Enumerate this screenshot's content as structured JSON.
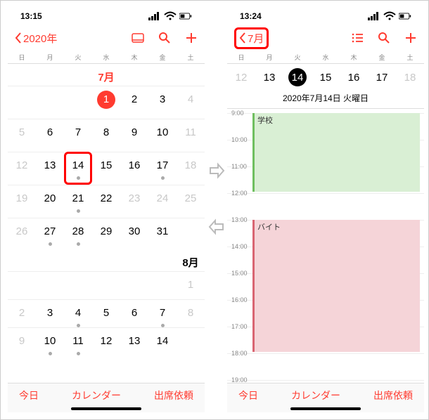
{
  "left": {
    "status_time": "13:15",
    "back_label": "2020年",
    "weekdays": [
      "日",
      "月",
      "火",
      "水",
      "木",
      "金",
      "土"
    ],
    "month_label": "7月",
    "next_month_label": "8月",
    "rows": [
      [
        null,
        null,
        null,
        {
          "n": "1",
          "today": true
        },
        {
          "n": "2"
        },
        {
          "n": "3"
        },
        {
          "n": "4",
          "dim": true
        }
      ],
      [
        {
          "n": "5",
          "dim": true
        },
        {
          "n": "6"
        },
        {
          "n": "7"
        },
        {
          "n": "8"
        },
        {
          "n": "9"
        },
        {
          "n": "10"
        },
        {
          "n": "11",
          "dim": true
        }
      ],
      [
        {
          "n": "12",
          "dim": true
        },
        {
          "n": "13"
        },
        {
          "n": "14",
          "dot": true,
          "hl": true
        },
        {
          "n": "15"
        },
        {
          "n": "16"
        },
        {
          "n": "17",
          "dot": true
        },
        {
          "n": "18",
          "dim": true
        }
      ],
      [
        {
          "n": "19",
          "dim": true
        },
        {
          "n": "20"
        },
        {
          "n": "21",
          "dot": true
        },
        {
          "n": "22"
        },
        {
          "n": "23",
          "dim": true
        },
        {
          "n": "24",
          "dim": true
        },
        {
          "n": "25",
          "dim": true
        }
      ],
      [
        {
          "n": "26",
          "dim": true
        },
        {
          "n": "27",
          "dot": true
        },
        {
          "n": "28",
          "dot": true
        },
        {
          "n": "29"
        },
        {
          "n": "30"
        },
        {
          "n": "31"
        },
        null
      ]
    ],
    "aug_rows": [
      [
        null,
        null,
        null,
        null,
        null,
        null,
        {
          "n": "1",
          "dim": true
        }
      ],
      [
        {
          "n": "2",
          "dim": true
        },
        {
          "n": "3"
        },
        {
          "n": "4",
          "dot": true
        },
        {
          "n": "5"
        },
        {
          "n": "6"
        },
        {
          "n": "7",
          "dot": true
        },
        {
          "n": "8",
          "dim": true
        }
      ],
      [
        {
          "n": "9",
          "dim": true
        },
        {
          "n": "10",
          "dot": true
        },
        {
          "n": "11",
          "dot": true
        },
        {
          "n": "12"
        },
        {
          "n": "13"
        },
        {
          "n": "14"
        },
        null
      ]
    ]
  },
  "right": {
    "status_time": "13:24",
    "back_label": "7月",
    "weekdays": [
      "日",
      "月",
      "火",
      "水",
      "木",
      "金",
      "土"
    ],
    "week_days": [
      {
        "n": "12",
        "dim": true
      },
      {
        "n": "13"
      },
      {
        "n": "14",
        "sel": true
      },
      {
        "n": "15"
      },
      {
        "n": "16"
      },
      {
        "n": "17"
      },
      {
        "n": "18",
        "dim": true
      }
    ],
    "date_title": "2020年7月14日 火曜日",
    "hours": [
      "9:00",
      "10:00",
      "11:00",
      "12:00",
      "13:00",
      "14:00",
      "15:00",
      "16:00",
      "17:00",
      "18:00",
      "19:00"
    ],
    "events": [
      {
        "title": "学校",
        "cls": "ev-green",
        "start": "9:00",
        "end": "12:00"
      },
      {
        "title": "バイト",
        "cls": "ev-red",
        "start": "13:00",
        "end": "18:00"
      }
    ]
  },
  "bottom": {
    "today": "今日",
    "calendars": "カレンダー",
    "inbox": "出席依頼"
  },
  "icons": {
    "signal": "•ıll",
    "wifi": "wifi",
    "battery": "batt"
  }
}
